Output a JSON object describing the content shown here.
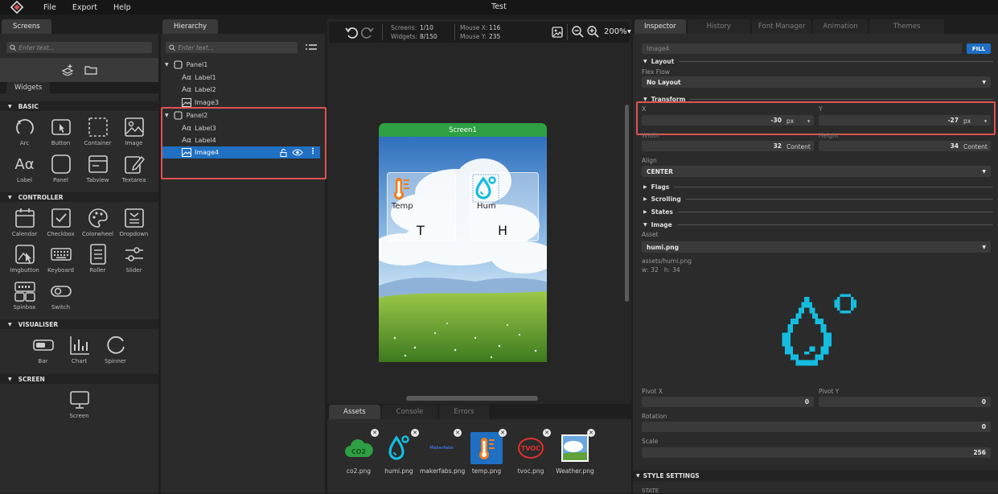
{
  "menubar": {
    "items": [
      "File",
      "Export",
      "Help"
    ],
    "title": "Test"
  },
  "left_panel": {
    "tabs": [
      "Screens",
      "Widgets"
    ],
    "search_placeholder": "Enter text...",
    "sections": [
      {
        "title": "BASIC",
        "widgets": [
          "Arc",
          "Button",
          "Container",
          "Image",
          "Label",
          "Panel",
          "Tabview",
          "Textarea"
        ]
      },
      {
        "title": "CONTROLLER",
        "widgets": [
          "Calendar",
          "Checkbox",
          "Colorwheel",
          "Dropdown",
          "Imgbutton",
          "Keyboard",
          "Roller",
          "Slider",
          "Spinbox",
          "Switch"
        ]
      },
      {
        "title": "VISUALISER",
        "widgets": [
          "Bar",
          "Chart",
          "Spinner"
        ]
      },
      {
        "title": "SCREEN",
        "widgets": [
          "Screen"
        ]
      }
    ]
  },
  "hierarchy": {
    "tab": "Hierarchy",
    "search_placeholder": "Enter text...",
    "nodes": [
      {
        "label": "Panel1",
        "type": "panel",
        "depth": 0
      },
      {
        "label": "Label1",
        "type": "label",
        "depth": 1
      },
      {
        "label": "Label2",
        "type": "label",
        "depth": 1
      },
      {
        "label": "Image3",
        "type": "image",
        "depth": 1
      },
      {
        "label": "Panel2",
        "type": "panel",
        "depth": 0
      },
      {
        "label": "Label3",
        "type": "label",
        "depth": 1
      },
      {
        "label": "Label4",
        "type": "label",
        "depth": 1
      },
      {
        "label": "Image4",
        "type": "image",
        "depth": 1,
        "selected": true
      }
    ]
  },
  "toolbar": {
    "screens_label": "Screens:",
    "screens_value": "1/10",
    "widgets_label": "Widgets:",
    "widgets_value": "8/150",
    "mousex_label": "Mouse X:",
    "mousex_value": "116",
    "mousey_label": "Mouse Y:",
    "mousey_value": "235",
    "zoom": "200%"
  },
  "canvas": {
    "screen_name": "Screen1",
    "card1_title": "Temp",
    "card1_value": "T",
    "card2_title": "Hum",
    "card2_value": "H",
    "colors": {
      "screen_header": "#2ea043",
      "temp_icon": "#f07d1a",
      "hum_icon": "#14bde0"
    }
  },
  "bottom": {
    "tabs": [
      "Assets",
      "Console",
      "Errors"
    ],
    "assets": [
      {
        "name": "co2.png",
        "icon": "co2-cloud-icon"
      },
      {
        "name": "humi.png",
        "icon": "humidity-drop-icon"
      },
      {
        "name": "makerfabs.png",
        "icon": "makerfabs-logo-icon",
        "thumb_text": "Makerfabs"
      },
      {
        "name": "temp.png",
        "icon": "thermometer-icon"
      },
      {
        "name": "tvoc.png",
        "icon": "tvoc-icon",
        "thumb_text": "TVOC"
      },
      {
        "name": "Weather.png",
        "icon": "weather-image-icon"
      }
    ]
  },
  "inspector": {
    "tabs": [
      "Inspector",
      "History",
      "Font Manager",
      "Animation",
      "Themes"
    ],
    "name_placeholder": "Image4",
    "fill_label": "FILL",
    "layout_header": "Layout",
    "flex_flow_label": "Flex Flow",
    "flex_flow_value": "No Layout",
    "transform_header": "Transform",
    "x_label": "X",
    "x_value": "-30",
    "x_unit": "px",
    "y_label": "Y",
    "y_value": "-27",
    "y_unit": "px",
    "width_label": "Width",
    "width_value": "32",
    "width_unit": "Content",
    "height_label": "Height",
    "height_value": "34",
    "height_unit": "Content",
    "align_label": "Align",
    "align_value": "CENTER",
    "flags_header": "Flags",
    "scrolling_header": "Scrolling",
    "states_header": "States",
    "image_header": "Image",
    "asset_label": "Asset",
    "asset_value": "humi.png",
    "asset_path": "assets/humi.png",
    "asset_w_label": "w:",
    "asset_w_value": "32",
    "asset_h_label": "h:",
    "asset_h_value": "34",
    "pivotx_label": "Pivot X",
    "pivotx_value": "0",
    "pivoty_label": "Pivot Y",
    "pivoty_value": "0",
    "rotation_label": "Rotation",
    "rotation_value": "0",
    "scale_label": "Scale",
    "scale_value": "256",
    "style_header": "STYLE SETTINGS",
    "state_label": "STATE",
    "accent": "#1f6fc2"
  }
}
